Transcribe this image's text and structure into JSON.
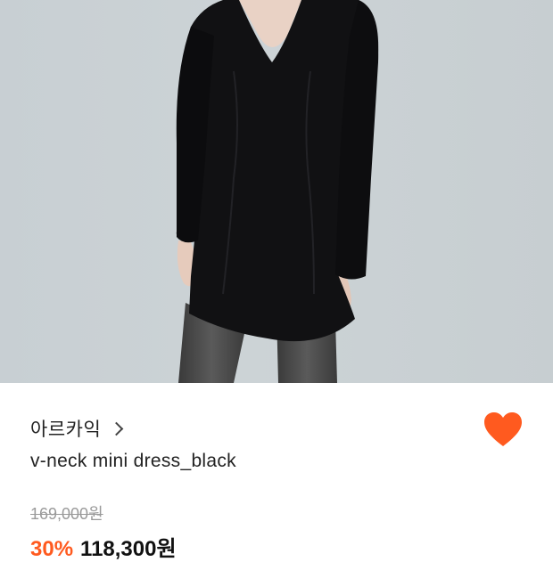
{
  "product_image": {
    "alt_semantic": "model-wearing-black-v-neck-mini-dress"
  },
  "brand": {
    "name": "아르카익",
    "chevron_icon": "chevron-right-icon"
  },
  "wishlist": {
    "icon": "heart-icon",
    "active": true,
    "color": "#ff5a1f"
  },
  "product": {
    "name": "v-neck mini dress_black"
  },
  "pricing": {
    "original_price": "169,000원",
    "discount": "30%",
    "sale_price": "118,300원",
    "discount_color": "#ff5a1f"
  }
}
